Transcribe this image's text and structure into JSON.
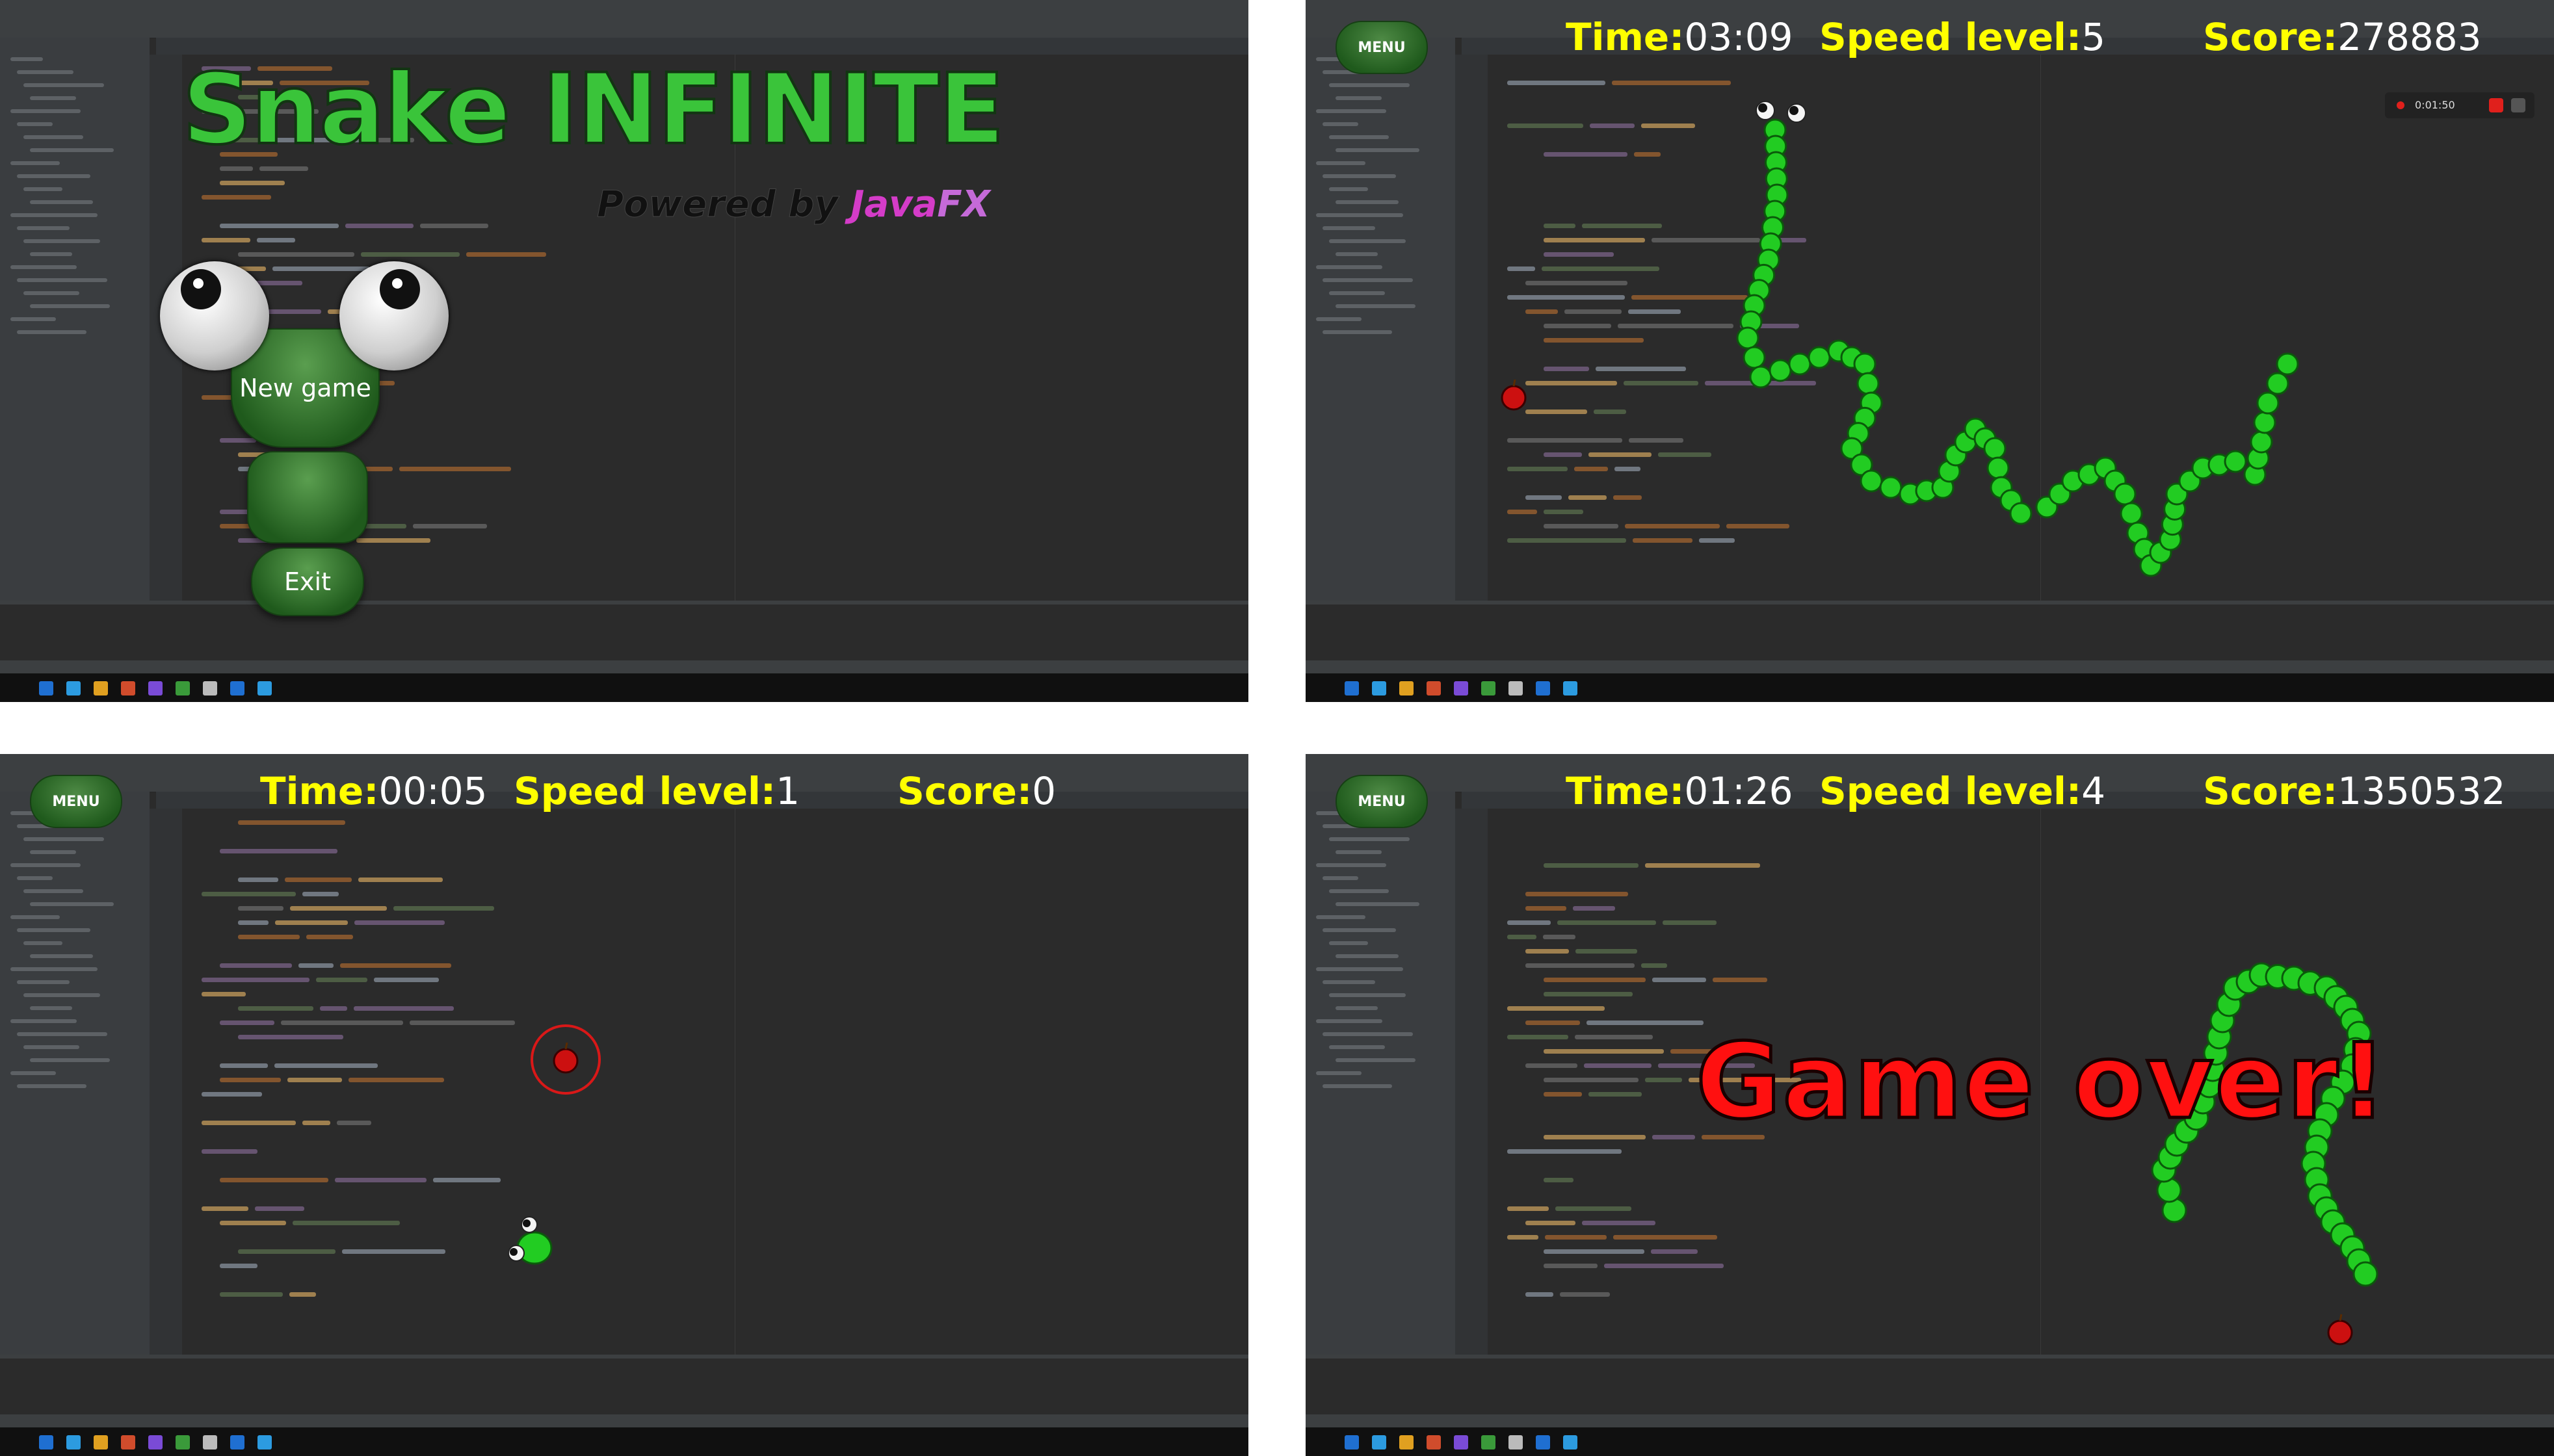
{
  "main_menu": {
    "title": "Snake INFINITE",
    "powered_prefix": "Powered by ",
    "powered_java": "Java",
    "powered_fx": "FX",
    "buttons": {
      "new_game": "New game",
      "middle": "",
      "exit": "Exit"
    }
  },
  "gameplay_1": {
    "menu_label": "MENU",
    "time_label": "Time:",
    "time": "03:09",
    "speed_label": "Speed level:",
    "speed": "5",
    "score_label": "Score:",
    "score": "278883",
    "recorder_time": "0:01:50"
  },
  "gameplay_2": {
    "menu_label": "MENU",
    "time_label": "Time:",
    "time": "00:05",
    "speed_label": "Speed level:",
    "speed": "1",
    "score_label": "Score:",
    "score": "0"
  },
  "game_over": {
    "menu_label": "MENU",
    "time_label": "Time:",
    "time": "01:26",
    "speed_label": "Speed level:",
    "speed": "4",
    "score_label": "Score:",
    "score": "1350532",
    "message": "Game over!"
  },
  "colors": {
    "snake_green": "#22cc22",
    "snake_outline": "#0a5a0a",
    "apple_red": "#cc1010",
    "hud_yellow": "#ffff00",
    "title_green": "#3ac43a",
    "ide_background": "#2b2b2b"
  }
}
